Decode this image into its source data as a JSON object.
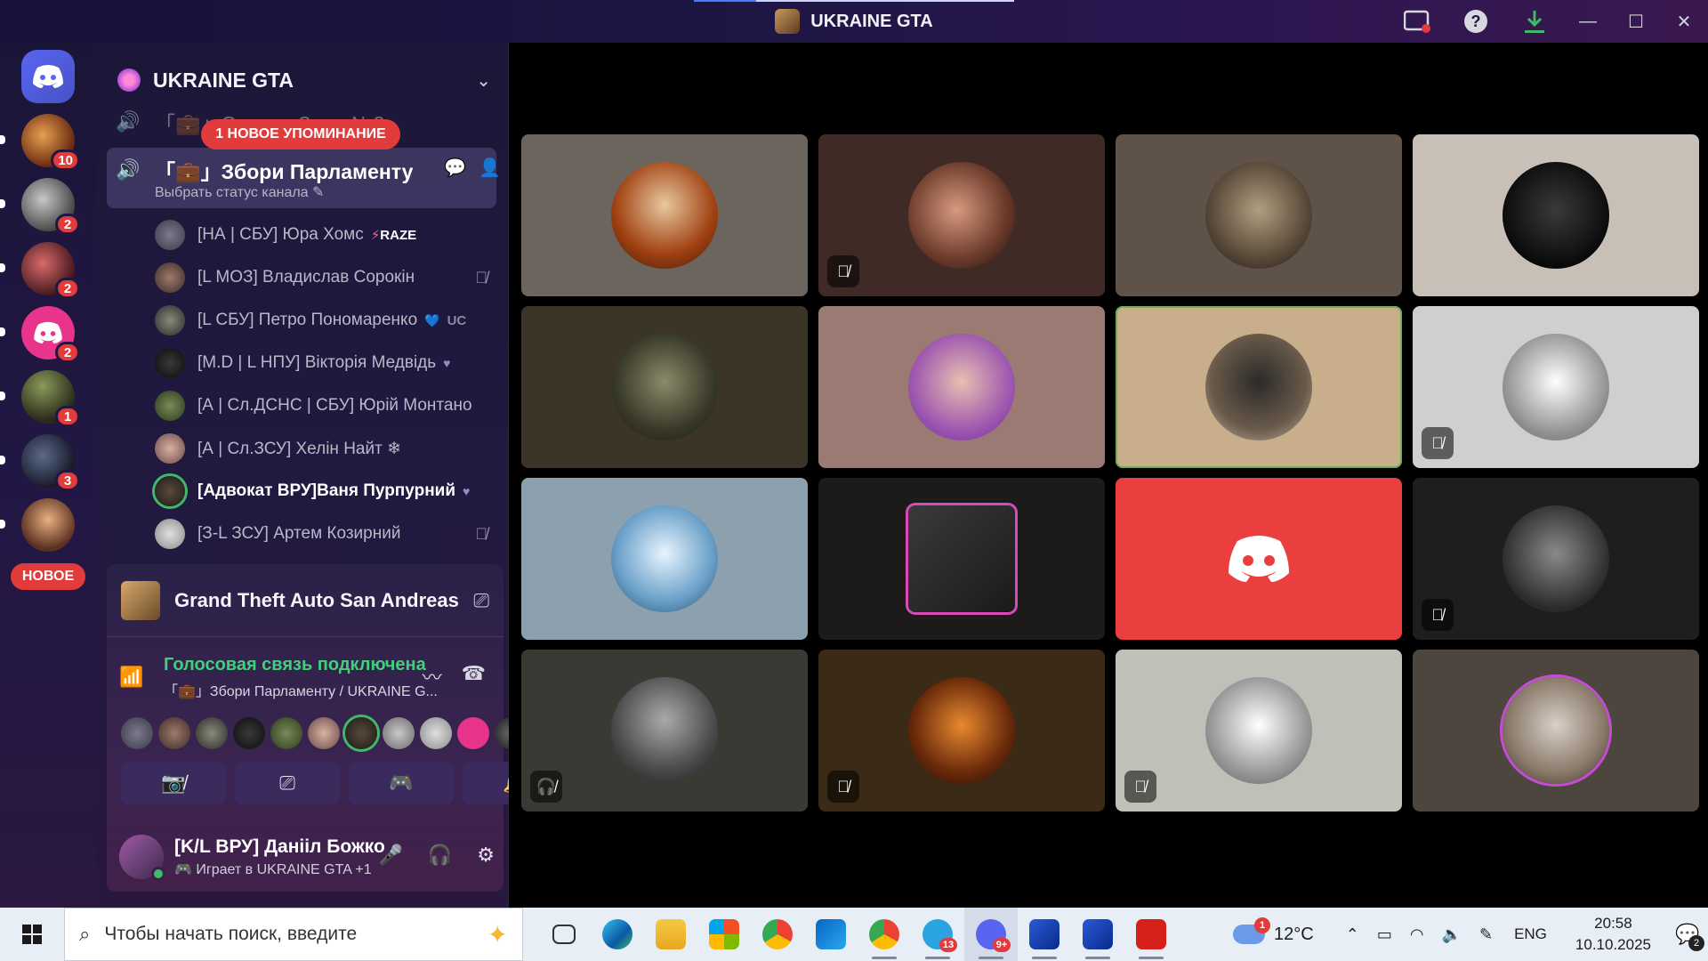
{
  "window": {
    "title": "UKRAINE GTA",
    "controls": [
      "screen-share-icon",
      "help-icon",
      "download-icon",
      "minimize-icon",
      "maximize-icon",
      "close-icon"
    ]
  },
  "rail": {
    "servers": [
      {
        "name": "discord-home",
        "badge": ""
      },
      {
        "name": "server-1",
        "badge": "10"
      },
      {
        "name": "server-2",
        "badge": "2"
      },
      {
        "name": "server-3",
        "badge": "2"
      },
      {
        "name": "server-4",
        "badge": "2"
      },
      {
        "name": "server-5",
        "badge": "1"
      },
      {
        "name": "server-6",
        "badge": "3"
      }
    ],
    "new_label": "НОВОЕ"
  },
  "sidebar": {
    "server_name": "UKRAINE GTA",
    "channel_above": "「💼」Сирена Зала №2",
    "mention_pill": "1 НОВОЕ УПОМИНАНИЕ",
    "active_channel": "「💼」Збори Парламенту",
    "channel_status": "Выбрать статус канала",
    "members": [
      {
        "name": "[НА | СБУ] Юра Хомс",
        "tag": "RAZE",
        "muted": false
      },
      {
        "name": "[L МОЗ] Владислав Сорокін",
        "tag": "",
        "muted": true
      },
      {
        "name": "[L СБУ] Петро Пономаренко",
        "tag": "UC",
        "muted": false
      },
      {
        "name": "[M.D | L НПУ] Вікторія Медвідь",
        "tag": "",
        "muted": false
      },
      {
        "name": "[А | Сл.ДСНС | СБУ] Юрій Монтано",
        "tag": "",
        "muted": false
      },
      {
        "name": "[А | Сл.ЗСУ] Хелін Найт ❄",
        "tag": "",
        "muted": false
      },
      {
        "name": "[Адвокат ВРУ]Ваня Пурпурний",
        "tag": "",
        "muted": false
      },
      {
        "name": "[З-L ЗСУ] Артем Козирний",
        "tag": "",
        "muted": true
      }
    ]
  },
  "activity": {
    "game": "Grand Theft Auto San Andreas",
    "voice_connected": "Голосовая связь подключена",
    "voice_channel": "「💼」Збори Парламенту / UKRAINE G...",
    "plus_label": "+"
  },
  "user": {
    "name": "[K/L ВРУ] Данііл Божко",
    "status": "Играет в UKRAINE GTA +1"
  },
  "taskbar": {
    "search_placeholder": "Чтобы начать поиск, введите",
    "telegram_badge": "13",
    "discord_badge": "9+",
    "weather_temp": "12°C",
    "weather_badge": "1",
    "language": "ENG",
    "time": "20:58",
    "date": "10.10.2025",
    "notifications": "2"
  },
  "colors": {
    "accent_red": "#e23b3b",
    "voice_green": "#3fd17a",
    "discord_blurple": "#5865f2"
  }
}
